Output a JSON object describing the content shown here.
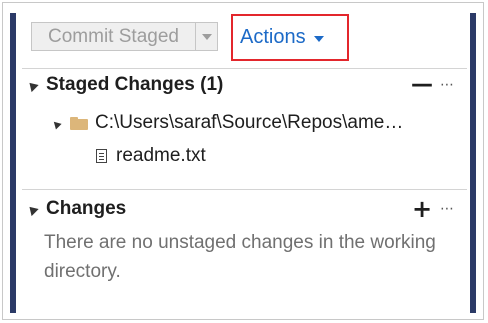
{
  "toolbar": {
    "commit_label": "Commit Staged",
    "actions_label": "Actions"
  },
  "staged": {
    "title": "Staged Changes (1)",
    "action_glyph": "—",
    "more_glyph": "⋯",
    "folder_path": "C:\\Users\\saraf\\Source\\Repos\\ame…",
    "file_name": "readme.txt"
  },
  "changes": {
    "title": "Changes",
    "action_glyph": "+",
    "more_glyph": "⋯",
    "empty_message": "There are no unstaged changes in the working directory."
  },
  "colors": {
    "accent_blue": "#1c6ac7",
    "highlight_red": "#e3262c",
    "side_bar": "#2b3a67",
    "folder": "#dcb67a"
  },
  "icons": [
    "dropdown-arrow-icon",
    "collapse-expander-icon",
    "folder-icon",
    "file-icon",
    "unstage-all-icon",
    "stage-all-icon",
    "more-options-icon"
  ]
}
